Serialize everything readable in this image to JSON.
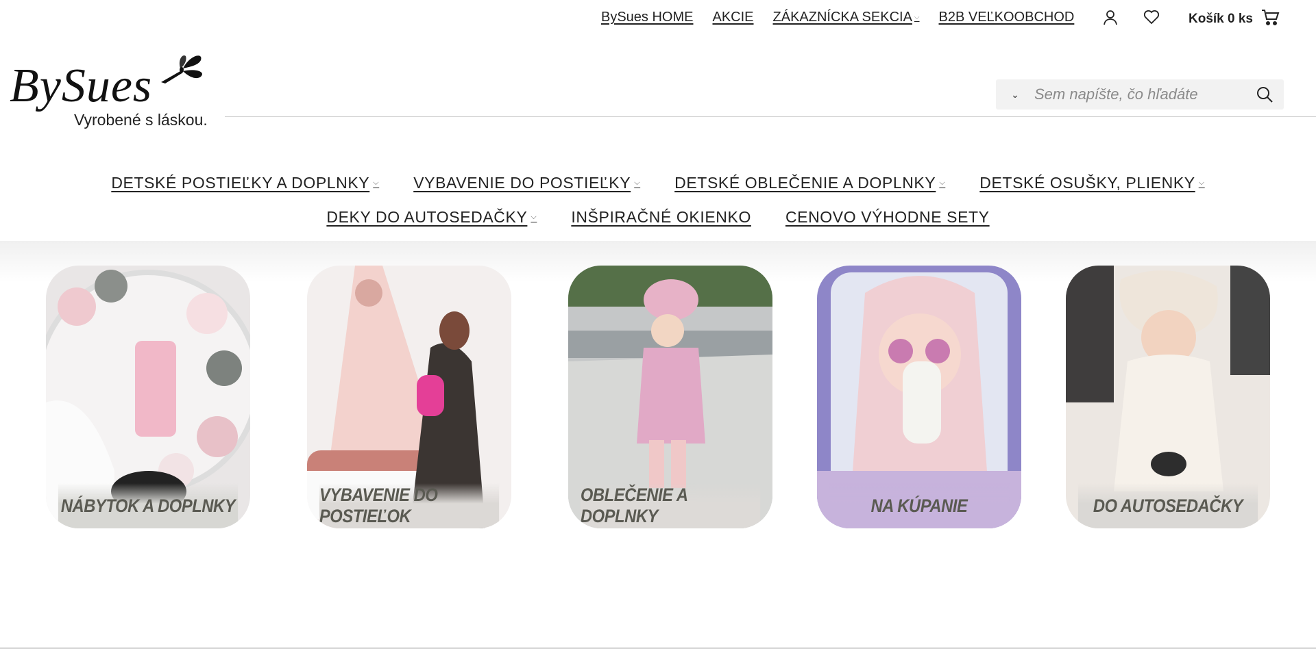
{
  "top_links": [
    {
      "label": "BySues HOME",
      "has_dropdown": false
    },
    {
      "label": "AKCIE",
      "has_dropdown": false
    },
    {
      "label": "ZÁKAZNÍCKA SEKCIA",
      "has_dropdown": true
    },
    {
      "label": "B2B VEĽKOOBCHOD",
      "has_dropdown": false
    }
  ],
  "icons": {
    "account": "user-icon",
    "wishlist": "heart-icon",
    "cart": "cart-icon",
    "search": "search-icon"
  },
  "cart": {
    "label": "Košík 0 ks"
  },
  "logo": {
    "main": "BySues",
    "tagline": "Vyrobené s láskou."
  },
  "search": {
    "placeholder": "Sem napíšte, čo hľadáte"
  },
  "nav": {
    "row1": [
      {
        "label": "DETSKÉ POSTIEĽKY A DOPLNKY",
        "has_dropdown": true
      },
      {
        "label": "VYBAVENIE DO POSTIEĽKY",
        "has_dropdown": true
      },
      {
        "label": "DETSKÉ OBLEČENIE A DOPLNKY",
        "has_dropdown": true
      },
      {
        "label": "DETSKÉ OSUŠKY, PLIENKY",
        "has_dropdown": true
      }
    ],
    "row2": [
      {
        "label": "DEKY DO AUTOSEDAČKY",
        "has_dropdown": true
      },
      {
        "label": "INŠPIRAČNÉ OKIENKO",
        "has_dropdown": false
      },
      {
        "label": "CENOVO VÝHODNE SETY",
        "has_dropdown": false
      }
    ]
  },
  "categories": [
    {
      "caption": "NÁBYTOK A DOPLNKY",
      "caption_bg": "#d7d7d3"
    },
    {
      "caption": "VYBAVENIE DO POSTIEĽOK",
      "caption_bg": "#dcd9d6"
    },
    {
      "caption": "OBLEČENIE A DOPLNKY",
      "caption_bg": "#dddad7"
    },
    {
      "caption": "NA KÚPANIE",
      "caption_bg": "#c7b3dc"
    },
    {
      "caption": "DO AUTOSEDAČKY",
      "caption_bg": "#dad8d5"
    }
  ],
  "colors": {
    "text": "#222222",
    "search_bg": "#f2f2f2",
    "caption_text": "#5a5a52"
  }
}
